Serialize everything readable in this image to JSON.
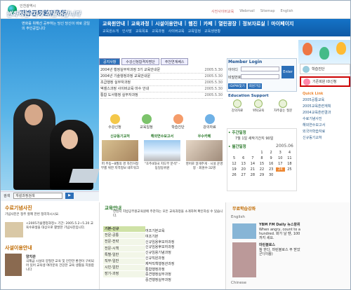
{
  "header": {
    "logo_sub": "인천광역시",
    "logo_title": "지방공무원교육원",
    "top_links": [
      "사전사이버교육",
      "Webmail",
      "Sitemap",
      "English"
    ]
  },
  "hero": {
    "slogan": "변화하는 자가 이끌어갑니다",
    "desc": "변화를 위해선 공부하는 당신 당신이 바로 궁일의 주인공입니다"
  },
  "nav": {
    "row1": [
      "교육원안내",
      "교육과정",
      "시설이용안내",
      "웹진",
      "카페",
      "열린광장",
      "정보자료실",
      "마이페이지"
    ],
    "row2": [
      "교육원소개",
      "인사말",
      "교육목표",
      "교육과정",
      "사이버교육",
      "교육일정",
      "교육생현황"
    ]
  },
  "notice": {
    "tabs": [
      "공지사항",
      "수강신청합격자명단",
      "주천연계쎄스"
    ],
    "items": [
      {
        "title": "2004년 행정실무자과정 3기 교육안내문",
        "date": "2005.5.30"
      },
      {
        "title": "2004년 기술행정과정 교육안내문",
        "date": "2005.5.30"
      },
      {
        "title": "초급행정 실무자과정",
        "date": "2005.5.30"
      },
      {
        "title": "엑셀스과정 사이버교육 마수 안내",
        "date": "2005.5.30"
      },
      {
        "title": "통합 도서행정 실무자과정",
        "date": "2005.5.30"
      }
    ]
  },
  "quick_icons": [
    "수강신청",
    "교육일정",
    "학습진단",
    "강의자료"
  ],
  "thumbs": [
    {
      "title": "신규동기교처",
      "cap": "퍼 주동~8월의 경 자전거정부를 위한 지역정보 네트워크"
    },
    {
      "title": "해외연수보고서",
      "cap": "\"호주4대국 지도부 분석\" -동일동위원"
    },
    {
      "title": "우수카페",
      "cap": "영어로 알게주게 · 시설 운영봉 · 회원수:32명"
    }
  ],
  "login": {
    "title": "Member Login",
    "id_label": "아이디",
    "pw_label": "비밀번호",
    "button": "Enter",
    "links": [
      "ID/PW찾기",
      "회원가입"
    ]
  },
  "edu_support": {
    "title": "Education Support",
    "items": [
      "강의자료",
      "위탁교육",
      "자주묻는 질문"
    ]
  },
  "schedule": {
    "week_title": "• 주간일정",
    "week_note": "7월 1일 새작기간지 90일",
    "month_title": "• 월간일정",
    "month": "2005.06",
    "days": [
      "1",
      "2",
      "3",
      "4",
      "5",
      "6",
      "7",
      "8",
      "9",
      "10",
      "11",
      "12",
      "13",
      "14",
      "15",
      "16",
      "17",
      "18",
      "19",
      "20",
      "21",
      "22",
      "23",
      "24",
      "25",
      "26",
      "27",
      "28",
      "29",
      "30"
    ]
  },
  "apply": [
    "학습진단",
    "기존회원 ID신청"
  ],
  "apply_sub": [
    "",
    "ID application"
  ],
  "quick_menu": {
    "title": "Quick Link",
    "items": [
      "2005공통교육",
      "2005교육훈련계획",
      "2004교육훈련결과",
      "수료기념사진",
      "해외연수보고서",
      "외국어학습자료",
      "신규동기교처"
    ]
  },
  "suggest": {
    "title": "수료기념사진",
    "text": "기념사진은 정주 할께 한번 정리하시시요.",
    "caption": "<2005기술행정과정> 기간: 2005.5.2~5.20 교육수료생을 대상으로 활발한 기념사진입니다."
  },
  "intro": {
    "title": "사설이용안내",
    "name": "양치관",
    "text": "국제급 시설의 양질한 교육 및 안전한 환경이 구비되어 있어 교육생 여러분의 건강한 교육 생활을 지원합니다"
  },
  "guide": {
    "title": "교육안내",
    "desc": "인천시 지방공무원교육원에 주관하는 모든 교육과정을 소개하여 확인하실 수 있습니다.",
    "cats": [
      {
        "label": "기본-신규",
        "head": true
      },
      {
        "label": "전문-공통",
        "head": false
      },
      {
        "label": "전문-전략",
        "head": false
      },
      {
        "label": "전문-시책",
        "head": false
      },
      {
        "label": "특별-일반",
        "head": false
      },
      {
        "label": "직무-일반",
        "head": false
      },
      {
        "label": "시민-일반",
        "head": false
      },
      {
        "label": "장기-과정",
        "head": false
      }
    ],
    "list": [
      "여조기본교육",
      "여조기본",
      "신규임용후보자과정",
      "신규임용후보자과정",
      "신규임용기념과정",
      "신규직원과정",
      "제작직책행정관과정",
      "통합행정과정",
      "중견행정실무과정",
      "중견행정실무과정"
    ]
  },
  "lang": {
    "title": "무료학습강좌",
    "en_label": "English",
    "en_head": "YBM FM Daily 뉴스항위",
    "en_text": "When angry, count to a hundred. 화가 날 땐, 100까지 세요.",
    "cn_head": "마린블로스",
    "cn_text": "참 한다. 마린블로스 부 받았군!(이쯤)",
    "cn_label": "Chinese"
  },
  "search": {
    "label": "검색",
    "select": "개설과정검색"
  },
  "more": "more"
}
